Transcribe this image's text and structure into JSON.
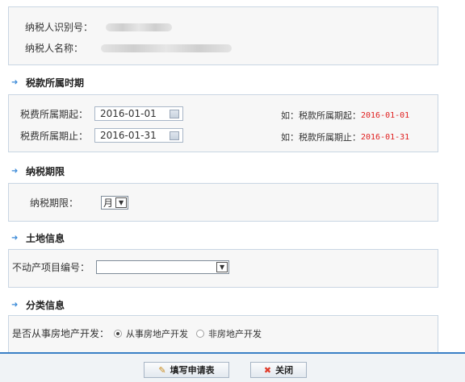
{
  "taxpayer": {
    "id_label": "纳税人识别号：",
    "name_label": "纳税人名称："
  },
  "tax_period_section": {
    "title": "税款所属时期",
    "start_label": "税费所属期起：",
    "start_value": "2016-01-01",
    "start_hint_prefix": "如：税款所属期起：",
    "start_hint_value": "2016-01-01",
    "end_label": "税费所属期止：",
    "end_value": "2016-01-31",
    "end_hint_prefix": "如：税款所属期止：",
    "end_hint_value": "2016-01-31"
  },
  "tax_term_section": {
    "title": "纳税期限",
    "label": "纳税期限：",
    "selected": "月"
  },
  "land_section": {
    "title": "土地信息",
    "label": "不动产项目编号：",
    "selected": ""
  },
  "category_section": {
    "title": "分类信息",
    "label": "是否从事房地产开发：",
    "options": [
      "从事房地产开发",
      "非房地产开发"
    ],
    "selected_index": 0
  },
  "footer": {
    "fill_button": "填写申请表",
    "close_button": "关闭"
  },
  "colors": {
    "accent": "#3a7fc6",
    "hint_red": "#e02020"
  },
  "icons": {
    "section_arrow": "arrow-right-icon",
    "date_picker": "calendar-icon",
    "fill": "pencil-icon",
    "close": "close-icon"
  }
}
